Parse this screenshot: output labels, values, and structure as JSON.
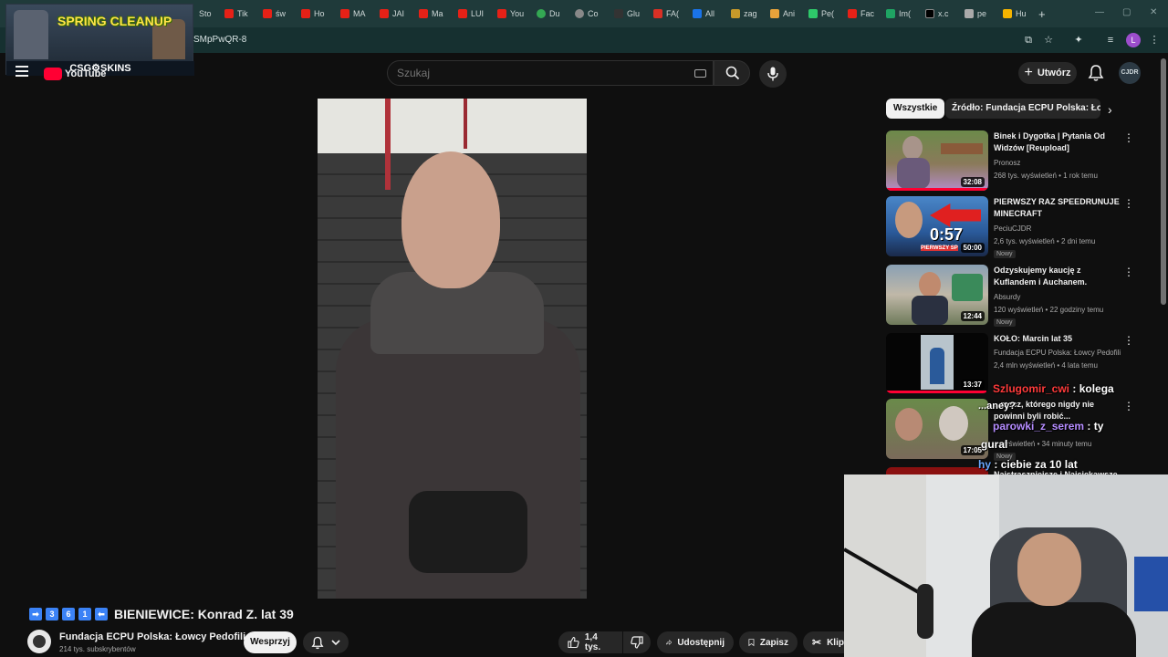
{
  "browser": {
    "tabs": [
      "Sto",
      "Tik",
      "św",
      "Ho",
      "MA",
      "JAI",
      "Ma",
      "LUI",
      "You",
      "Du",
      "Co",
      "Glu",
      "FA(",
      "All",
      "zag",
      "Ani",
      "Pe(",
      "Fac",
      "Im(",
      "x.c",
      "pe",
      "Hu"
    ],
    "url": "SMpPwQR-8"
  },
  "overlay": {
    "title": "SPRING CLEANUP",
    "brand": "CSG⚙SKINS"
  },
  "header": {
    "logo_text": "YouTube",
    "search_placeholder": "Szukaj",
    "create_label": "Utwórz",
    "avatar_text": "CJDR"
  },
  "video": {
    "title": "BIENIEWICE: Konrad Z. lat 39",
    "title_emojis": [
      "➡",
      "3",
      "6",
      "1",
      "⬅"
    ],
    "channel": "Fundacja ECPU Polska: Łowcy Pedofili",
    "subscribers": "214 tys. subskrybentów",
    "support_label": "Wesprzyj",
    "likes": "1,4 tys.",
    "share_label": "Udostępnij",
    "save_label": "Zapisz",
    "clip_label": "Klip"
  },
  "sidebar": {
    "chips": [
      "Wszystkie",
      "Źródło: Fundacja ECPU Polska: Łowcy Pedofili"
    ],
    "items": [
      {
        "title": "Binek i Dygotka | Pytania Od Widzów [Reupload]",
        "channel": "Pronosz",
        "meta": "268 tys. wyświetleń • 1 rok temu",
        "duration": "32:08",
        "new": "",
        "progress": 1.0
      },
      {
        "title": "PIERWSZY RAZ SPEEDRUNUJE MINECRAFT",
        "channel": "PeciuCJDR",
        "meta": "2,6 tys. wyświetleń • 2 dni temu",
        "duration": "50:00",
        "new": "Nowy",
        "progress": 0
      },
      {
        "title": "Odzyskujemy kaucję z Kuflandem i Auchanem. Kolejn...",
        "channel": "Absurdy",
        "meta": "120 wyświetleń • 22 godziny temu",
        "duration": "12:44",
        "new": "Nowy",
        "progress": 0
      },
      {
        "title": "KOŁO: Marcin lat 35",
        "channel": "Fundacja ECPU Polska: Łowcy Pedofili",
        "meta": "2,4 mln wyświetleń • 4 lata temu",
        "duration": "13:37",
        "new": "",
        "progress": 0.98
      },
      {
        "title": "...rzecz, którego nigdy nie powinni byli robić...",
        "channel": "",
        "meta": "...wyświetleń • 34 minuty temu",
        "duration": "17:05",
        "new": "Nowy",
        "progress": 0
      },
      {
        "title": "Najstraszniejsze i Najciekawsze",
        "channel": "",
        "meta": "",
        "duration": "",
        "new": "",
        "progress": 0
      }
    ]
  },
  "thumb_overlay_text": {
    "timer": "0:57",
    "first": "PIERWSZY SP"
  },
  "chat": [
    {
      "user": "Szlugomir_cwi",
      "text": ": kolega"
    },
    {
      "user": "",
      "text": "...aney?"
    },
    {
      "user": "parowki_z_serem",
      "text": ": ty"
    },
    {
      "user": "",
      "text": "gural"
    },
    {
      "user": "hy",
      "text": ": ciebie za 10 lat"
    }
  ],
  "colors": {
    "accent": "#ff0033",
    "bg": "#0f0f0f",
    "chip": "#272727"
  }
}
